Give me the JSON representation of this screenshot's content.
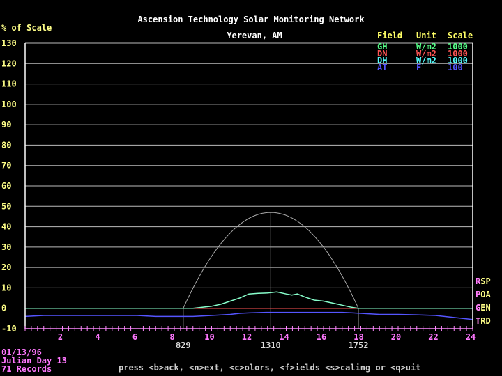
{
  "chart_data": {
    "type": "line",
    "title": "Ascension Technology Solar Monitoring Network",
    "subtitle": "Yerevan, AM",
    "ylabel": "% of Scale",
    "ylim": [
      -10,
      130
    ],
    "yticks": [
      130,
      120,
      110,
      100,
      90,
      80,
      70,
      60,
      50,
      40,
      30,
      20,
      10,
      0,
      -10
    ],
    "xlim": [
      0,
      24
    ],
    "xticks": [
      2,
      4,
      6,
      8,
      10,
      12,
      14,
      16,
      18,
      20,
      22,
      24
    ],
    "grid": true,
    "legend": {
      "placement": "top-right",
      "headers": [
        "Field",
        "Unit",
        "Scale"
      ],
      "entries": [
        {
          "field": "GH",
          "unit": "W/m2",
          "scale": "1000",
          "color": "#55ff88"
        },
        {
          "field": "DN",
          "unit": "W/m2",
          "scale": "1000",
          "color": "#ff5555"
        },
        {
          "field": "DH",
          "unit": "W/m2",
          "scale": "1000",
          "color": "#55ffff"
        },
        {
          "field": "AT",
          "unit": "F",
          "scale": "100",
          "color": "#5555ff"
        }
      ]
    },
    "markers": [
      {
        "label": "829",
        "x": 8.48
      },
      {
        "label": "1310",
        "x": 13.17
      },
      {
        "label": "1752",
        "x": 17.87
      }
    ],
    "clear_sky": {
      "start": 8.48,
      "peak_x": 13.17,
      "peak_y": 47,
      "end": 17.87,
      "color": "#aaaaaa"
    },
    "series": [
      {
        "name": "GH",
        "color": "#88ffcc",
        "x": [
          0,
          9,
          9.5,
          10,
          10.5,
          11,
          11.5,
          12,
          12.5,
          13,
          13.5,
          14,
          14.3,
          14.6,
          15,
          15.5,
          16,
          16.5,
          17,
          17.5,
          17.87,
          24
        ],
        "y": [
          0,
          0,
          0.5,
          1,
          2,
          3.5,
          5,
          7,
          7.3,
          7.5,
          8,
          7,
          6.5,
          7,
          5.5,
          4,
          3.5,
          2.5,
          1.5,
          0.5,
          0,
          0
        ]
      },
      {
        "name": "DN",
        "color": "#ff5555",
        "x": [
          9,
          17.8
        ],
        "y": [
          0,
          0
        ]
      },
      {
        "name": "DH",
        "color": "#66dddd",
        "x": [
          0,
          24
        ],
        "y": [
          0,
          0
        ]
      },
      {
        "name": "AT",
        "color": "#5555ff",
        "x": [
          0,
          1,
          6,
          7,
          9,
          10,
          11,
          11.5,
          12,
          13,
          17,
          18,
          19,
          20,
          21,
          22,
          23,
          24
        ],
        "y": [
          -4,
          -3.5,
          -3.5,
          -4,
          -4,
          -3.5,
          -3,
          -2.5,
          -2.3,
          -2,
          -2,
          -2.5,
          -3,
          -3,
          -3.2,
          -3.5,
          -4.5,
          -5.5
        ]
      }
    ],
    "right_labels": [
      "RSP",
      "POA",
      "GEN",
      "TRD"
    ]
  },
  "footer": {
    "date": "01/13/96",
    "julian": "Julian Day 13",
    "records": "71 Records",
    "help": "press <b>ack, <n>ext, <c>olors, <f>ields <s>caling or <q>uit"
  }
}
